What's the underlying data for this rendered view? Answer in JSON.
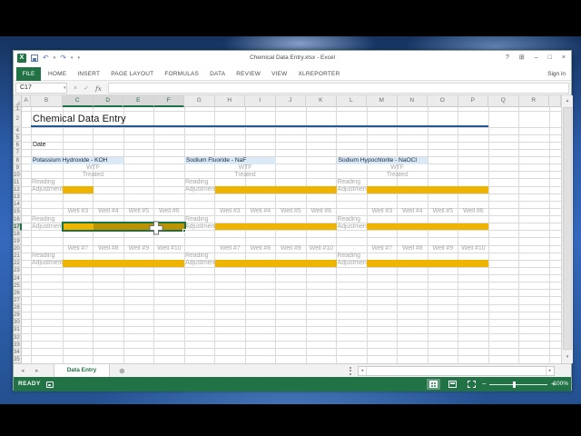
{
  "window_title": "Chemical Data Entry.xlsx - Excel",
  "titlebar": {
    "sign_in": "Sign in"
  },
  "icons": {
    "excel_logo": "X",
    "undo": "↶",
    "redo": "↷",
    "dropdown": "▾",
    "help": "?",
    "ribbon_display": "⊞",
    "minimize": "–",
    "maximize": "□",
    "close": "×",
    "name_dropdown": "▾",
    "cancel": "×",
    "enter": "✓",
    "fx": "fx",
    "prev_sheet": "◂",
    "next_sheet": "▸",
    "add_sheet": "⊕",
    "scroll_up": "▴",
    "scroll_down": "▾",
    "scroll_left": "◂",
    "scroll_right": "▸",
    "zoom_out": "−",
    "zoom_in": "+"
  },
  "ribbon_tabs": [
    {
      "label": "FILE"
    },
    {
      "label": "HOME"
    },
    {
      "label": "INSERT"
    },
    {
      "label": "PAGE LAYOUT"
    },
    {
      "label": "FORMULAS"
    },
    {
      "label": "DATA"
    },
    {
      "label": "REVIEW"
    },
    {
      "label": "VIEW"
    },
    {
      "label": "XLREPORTER"
    }
  ],
  "formula_bar": {
    "name_box": "C17",
    "formula_value": ""
  },
  "sheet": {
    "columns": [
      "A",
      "B",
      "C",
      "D",
      "E",
      "F",
      "G",
      "H",
      "I",
      "J",
      "K",
      "L",
      "M",
      "N",
      "O",
      "P",
      "Q",
      "R"
    ],
    "visible_rows": [
      1,
      2,
      4,
      5,
      6,
      7,
      8,
      9,
      10,
      11,
      12,
      13,
      14,
      15,
      16,
      17,
      18,
      19,
      20,
      21,
      22,
      23,
      24,
      25,
      26,
      27,
      28,
      29,
      30,
      31,
      32,
      33,
      34,
      35
    ],
    "hidden_rows": [
      3
    ],
    "title": "Chemical Data Entry",
    "date_label": "Date",
    "sections": [
      {
        "title": "Potassium Hydroxide - KOH"
      },
      {
        "title": "Sodium Fluoride - NaF"
      },
      {
        "title": "Sodium Hypochlorite - NaOCl"
      }
    ],
    "labels": {
      "wtf": "WTF",
      "treated": "Treated",
      "reading": "Reading",
      "adjustment": "Adjustment"
    },
    "wells_top": [
      "Well #3",
      "Well #4",
      "Well #5",
      "Well #6"
    ],
    "wells_bottom": [
      "Well #7",
      "Well #8",
      "Well #9",
      "Well #10"
    ],
    "selection": {
      "active_cell": "C17",
      "range": "C17:F17"
    }
  },
  "colors": {
    "gold": "#EDB501",
    "gold_selected": "#BB9201",
    "section_fill": "#DBE8F6",
    "title_rule": "#24578F",
    "selection_green": "#1E7145",
    "excel_green": "#217346"
  },
  "sheet_tabs": {
    "active_tab": "Data Entry"
  },
  "status_bar": {
    "mode": "READY",
    "zoom_level": "100%"
  }
}
